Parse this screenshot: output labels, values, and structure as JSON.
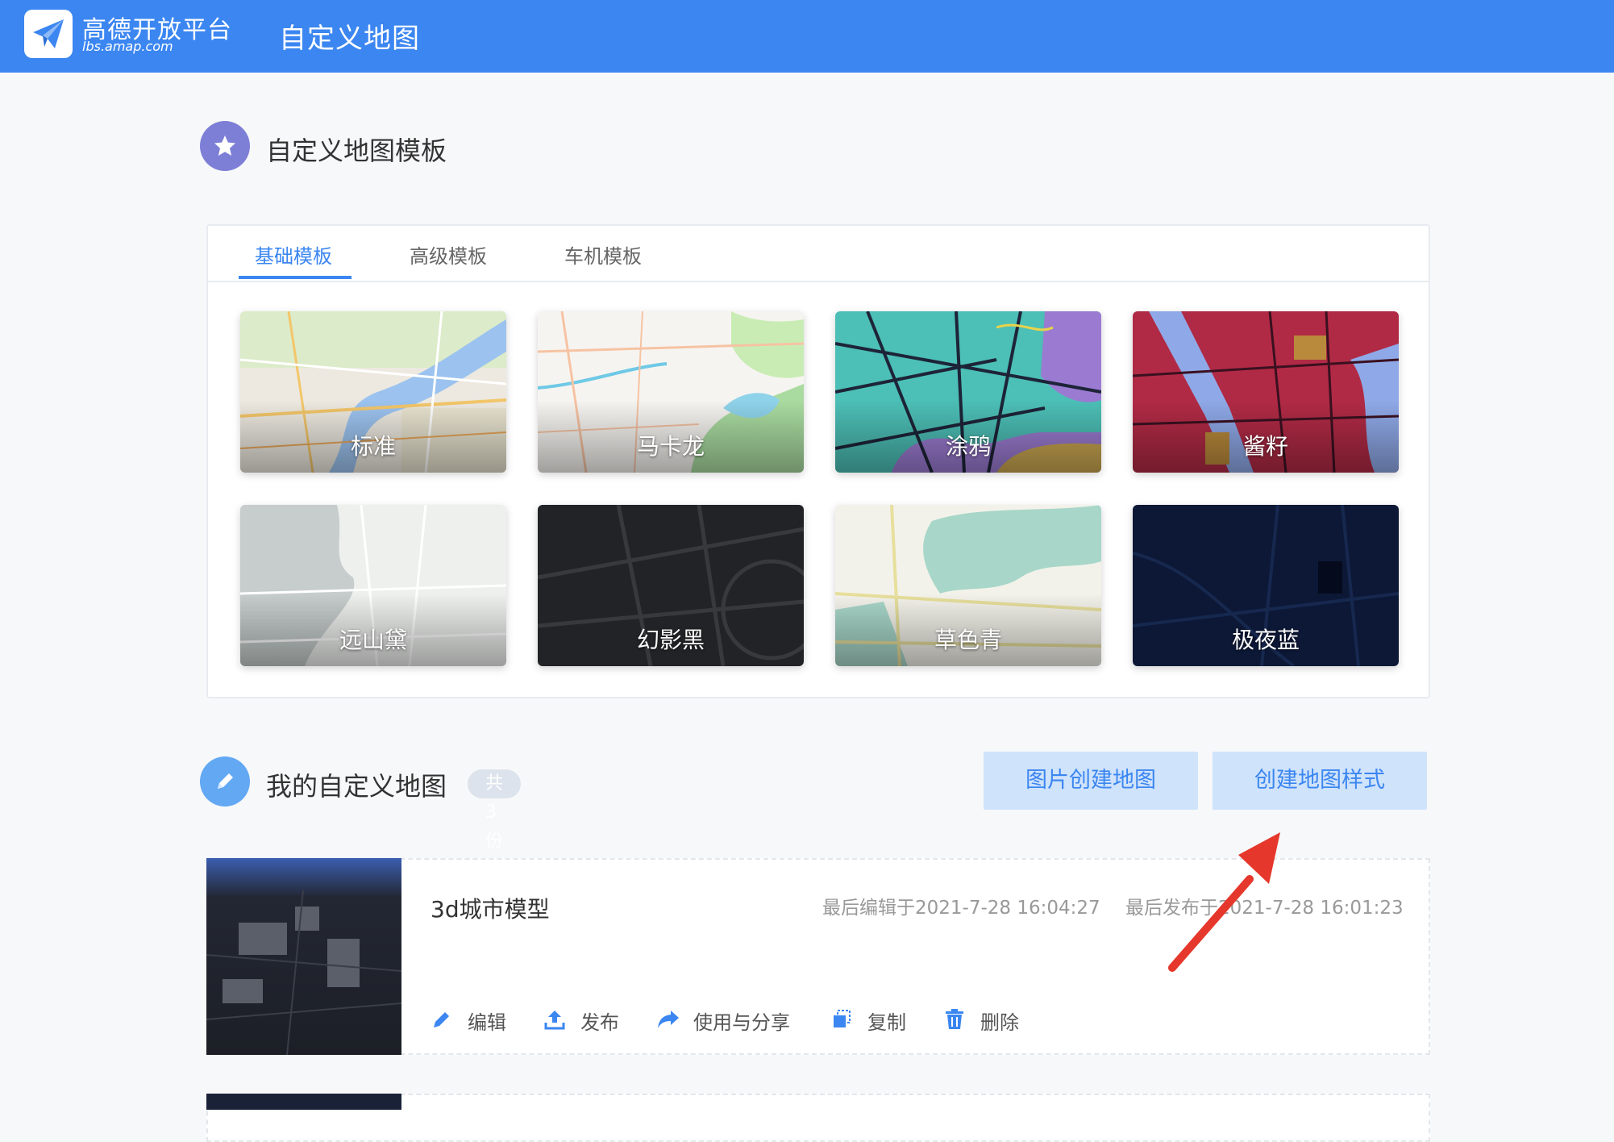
{
  "header": {
    "logo_name": "高德开放平台",
    "logo_domain": "lbs.amap.com",
    "app_title": "自定义地图",
    "brand_color": "#3b86f1"
  },
  "templates": {
    "title": "自定义地图模板",
    "icon": "star-icon",
    "tabs": [
      {
        "label": "基础模板",
        "active": true
      },
      {
        "label": "高级模板",
        "active": false
      },
      {
        "label": "车机模板",
        "active": false
      }
    ],
    "cards": [
      {
        "label": "标准"
      },
      {
        "label": "马卡龙"
      },
      {
        "label": "涂鸦"
      },
      {
        "label": "酱籽"
      },
      {
        "label": "远山黛"
      },
      {
        "label": "幻影黑"
      },
      {
        "label": "草色青"
      },
      {
        "label": "极夜蓝"
      }
    ]
  },
  "my_maps": {
    "title": "我的自定义地图",
    "icon": "pencil-icon",
    "count_badge": "共3份",
    "buttons": {
      "image_create": "图片创建地图",
      "create_style": "创建地图样式"
    },
    "items": [
      {
        "name": "3d城市模型",
        "last_edit": "最后编辑于2021-7-28 16:04:27",
        "last_publish": "最后发布于2021-7-28 16:01:23",
        "actions": [
          {
            "label": "编辑",
            "icon": "edit-icon"
          },
          {
            "label": "发布",
            "icon": "upload-icon"
          },
          {
            "label": "使用与分享",
            "icon": "share-icon"
          },
          {
            "label": "复制",
            "icon": "copy-icon"
          },
          {
            "label": "删除",
            "icon": "trash-icon"
          }
        ]
      }
    ]
  }
}
